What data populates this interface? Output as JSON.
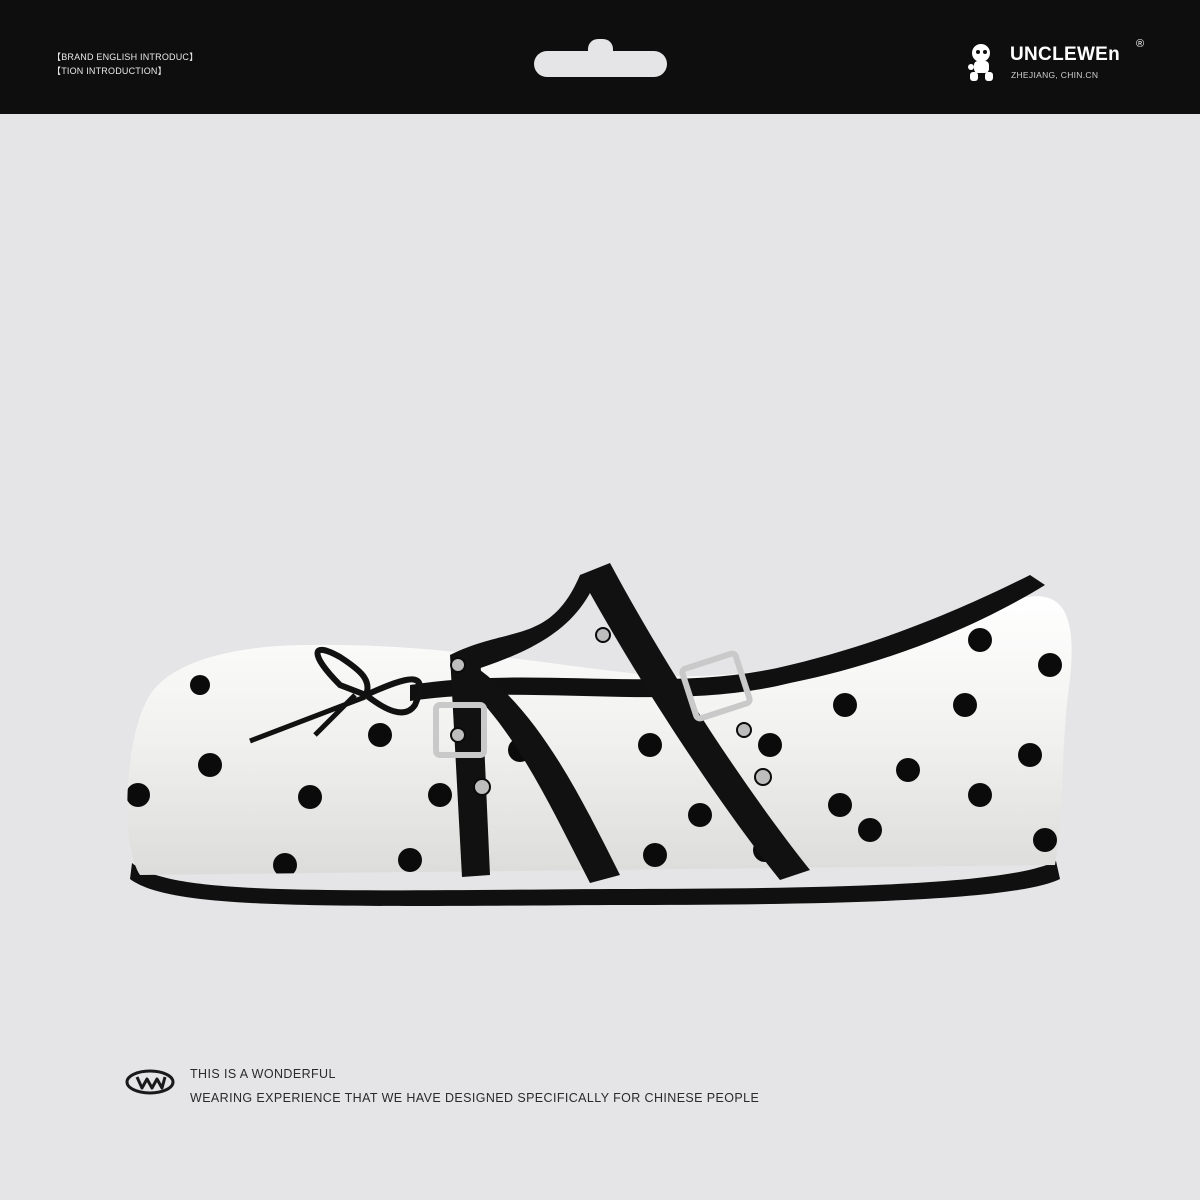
{
  "header": {
    "intro_line_1": "【BRAND ENGLISH INTRODUC】",
    "intro_line_2": "【TION INTRODUCTION】",
    "brand_name": "UNCLEWEn",
    "brand_registered": "®",
    "brand_location": "ZHEJIANG, CHIN.CN"
  },
  "product": {
    "image": "polka-dot-mary-jane-flat-shoe",
    "colors": {
      "upper": "#f2f2f0",
      "dots": "#0b0b0b",
      "trim": "#111111",
      "hardware": "#c9c9c9"
    }
  },
  "footer": {
    "line_1": "THIS IS A WONDERFUL",
    "line_2": "WEARING EXPERIENCE THAT WE HAVE DESIGNED SPECIFICALLY FOR CHINESE PEOPLE"
  }
}
